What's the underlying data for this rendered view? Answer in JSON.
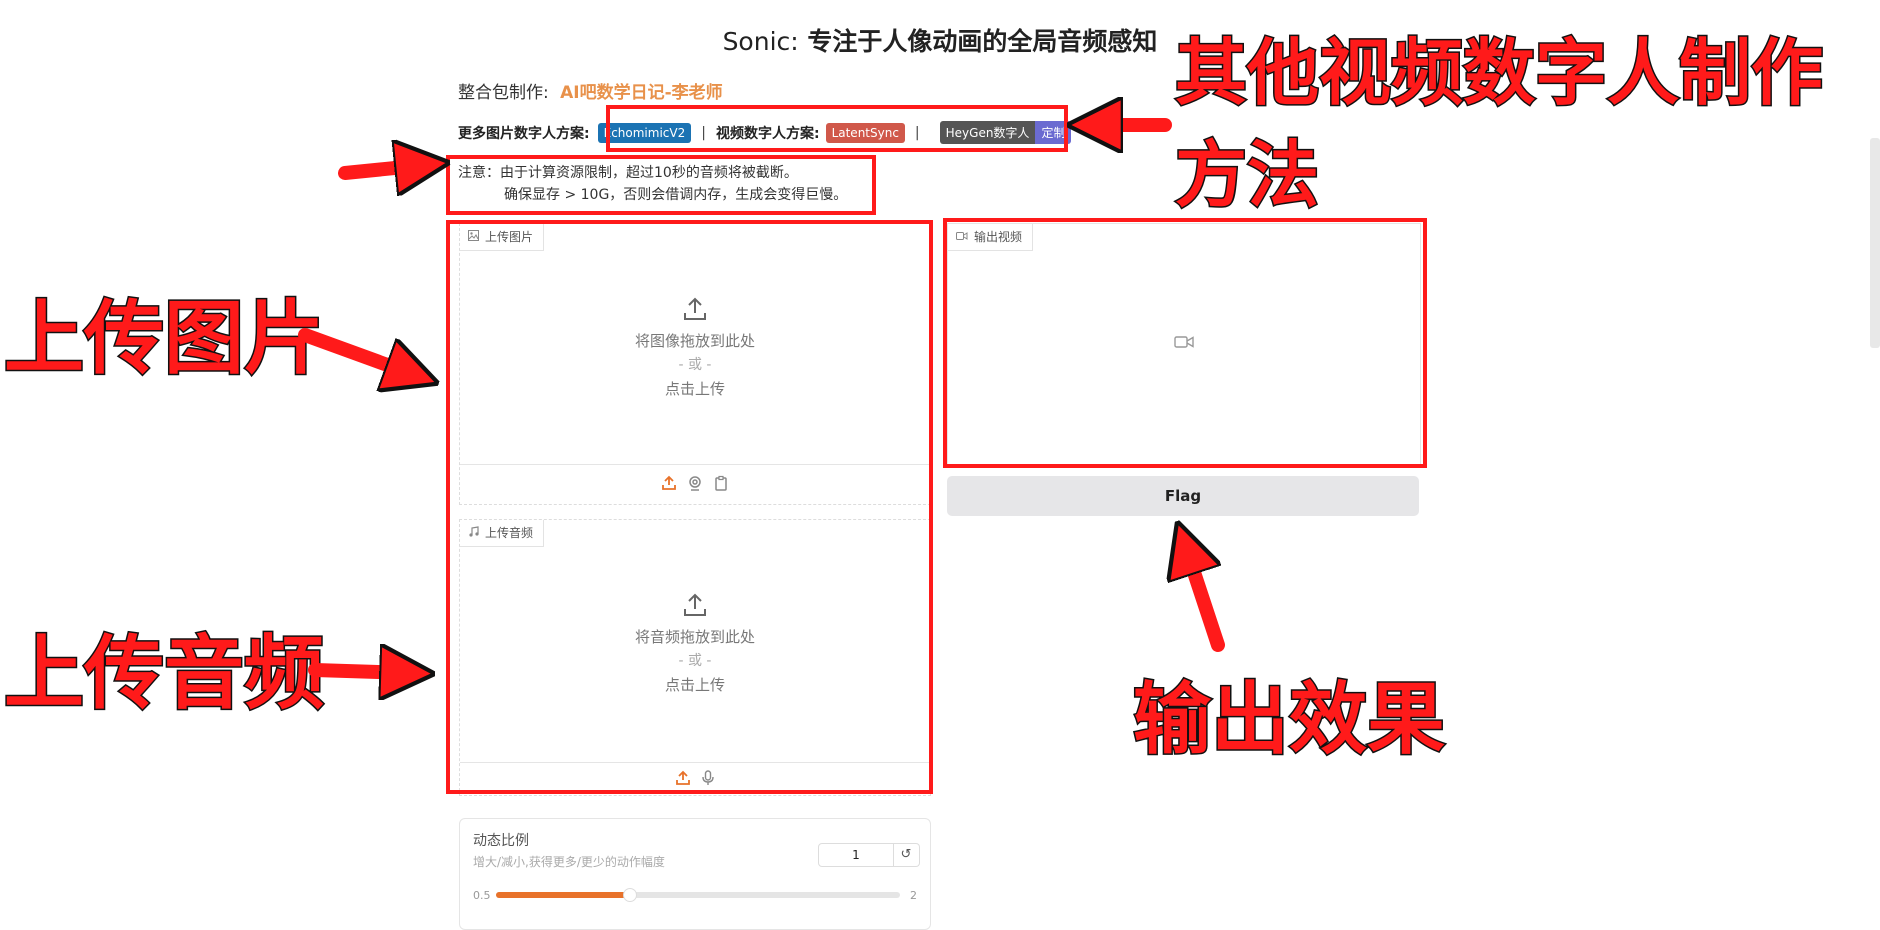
{
  "header": {
    "title_prefix": "Sonic:",
    "title_main": "专注于人像动画的全局音频感知",
    "credit_label": "整合包制作:",
    "credit_author": "AI吧数学日记-李老师",
    "more_image_label": "更多图片数字人方案:",
    "badge_echomimic": "EchomimicV2",
    "separator": "|",
    "more_video_label": "视频数字人方案:",
    "badge_latentsync": "LatentSync",
    "badge_heygen": "HeyGen数字人",
    "badge_custom": "定制"
  },
  "notice": {
    "line1": "注意：由于计算资源限制，超过10秒的音频将被截断。",
    "line2": "确保显存 > 10G，否则会借调内存，生成会变得巨慢。"
  },
  "image_upload": {
    "tag": "上传图片",
    "drop_text": "将图像拖放到此处",
    "or_text": "- 或 -",
    "click_text": "点击上传"
  },
  "audio_upload": {
    "tag": "上传音频",
    "drop_text": "将音频拖放到此处",
    "or_text": "- 或 -",
    "click_text": "点击上传"
  },
  "output": {
    "tag": "输出视频",
    "flag_label": "Flag"
  },
  "slider": {
    "label": "动态比例",
    "info": "增大/减小,获得更多/更少的动作幅度",
    "value": "1",
    "min": "0.5",
    "max": "2",
    "fill_fraction": 0.33,
    "reset_icon": "↺"
  },
  "annotations": {
    "other_methods": "其他视频数字人制作",
    "other_methods_2": "方法",
    "upload_image": "上传图片",
    "upload_audio": "上传音频",
    "output_effect": "输出效果"
  },
  "colors": {
    "accent": "#e8722a",
    "annotation_red": "#ff1a1a",
    "badge_blue": "#1b73b3",
    "badge_orange": "#d0584a",
    "badge_purple": "#6b6bd1"
  }
}
